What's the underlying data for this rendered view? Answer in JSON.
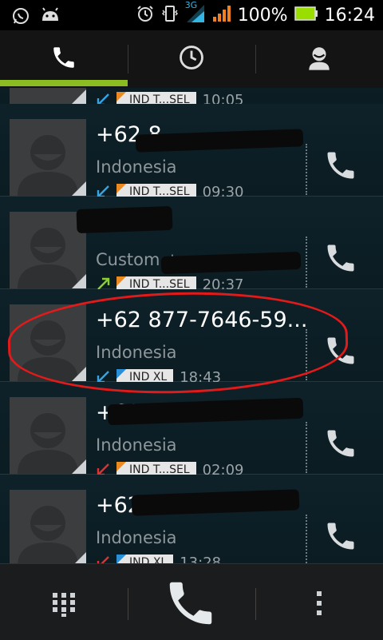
{
  "status_bar": {
    "network": "3G",
    "battery": "100%",
    "time": "16:24",
    "icons": [
      "whatsapp-icon",
      "android-icon",
      "alarm-icon",
      "vibrate-icon",
      "wifi-icon",
      "signal-icon",
      "battery-icon"
    ]
  },
  "tabs": [
    {
      "name": "tab-phone",
      "icon": "phone-icon",
      "active": true
    },
    {
      "name": "tab-call-log",
      "icon": "clock-icon",
      "active": false
    },
    {
      "name": "tab-contacts",
      "icon": "person-icon",
      "active": false
    }
  ],
  "calls": [
    {
      "number": "",
      "country": "",
      "sim": "IND T...SEL",
      "time": "10:05",
      "direction": "incoming",
      "sim_color": "orange"
    },
    {
      "number": "+62 8",
      "country": "Indonesia",
      "sim": "IND T...SEL",
      "time": "09:30",
      "direction": "incoming",
      "sim_color": "orange"
    },
    {
      "number": "",
      "country": "Custom +",
      "sim": "IND T...SEL",
      "time": "20:37",
      "direction": "outgoing",
      "sim_color": "orange"
    },
    {
      "number": "+62 877-7646-59...",
      "country": "Indonesia",
      "sim": "IND XL",
      "time": "18:43",
      "direction": "incoming",
      "sim_color": "blue"
    },
    {
      "number": "+62 8",
      "country": "Indonesia",
      "sim": "IND T...SEL",
      "time": "02:09",
      "direction": "missed",
      "sim_color": "orange"
    },
    {
      "number": "+62 8",
      "country": "Indonesia",
      "sim": "IND XL",
      "time": "13:28",
      "direction": "missed",
      "sim_color": "blue"
    }
  ],
  "colors": {
    "accent": "#8bbd22",
    "incoming": "#33a4e6",
    "outgoing": "#8bd12b",
    "missed": "#e23030",
    "highlight": "#e21a1a"
  },
  "bottom_bar": {
    "icons": [
      "dialpad-icon",
      "phone-icon",
      "menu-icon"
    ]
  }
}
